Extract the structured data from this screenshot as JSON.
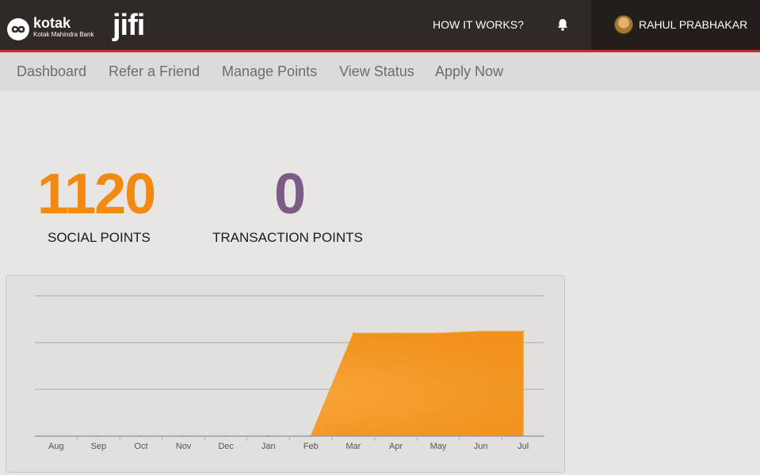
{
  "header": {
    "brand": {
      "name": "kotak",
      "subtitle": "Kotak Mahindra Bank",
      "product": "jifi"
    },
    "how_it_works": "HOW IT WORKS?",
    "notification_icon": "bell-icon",
    "user_name": "RAHUL PRABHAKAR",
    "accent_color": "#c8302f"
  },
  "nav": {
    "items": [
      {
        "label": "Dashboard"
      },
      {
        "label": "Refer a Friend"
      },
      {
        "label": "Manage Points"
      },
      {
        "label": "View Status"
      },
      {
        "label": "Apply Now"
      }
    ]
  },
  "stats": {
    "social": {
      "value": "1120",
      "label": "SOCIAL POINTS",
      "color": "#f08a12"
    },
    "transaction": {
      "value": "0",
      "label": "TRANSACTION POINTS",
      "color": "#7a5c86"
    }
  },
  "chart_data": {
    "type": "area",
    "categories": [
      "Aug",
      "Sep",
      "Oct",
      "Nov",
      "Dec",
      "Jan",
      "Feb",
      "Mar",
      "Apr",
      "May",
      "Jun",
      "Jul"
    ],
    "series": [
      {
        "values": [
          0,
          0,
          0,
          0,
          0,
          0,
          0,
          1100,
          1100,
          1100,
          1120,
          1120
        ],
        "color": "#f39a2a"
      }
    ],
    "ylim": [
      0,
      1500
    ],
    "grid": true,
    "xlabel": "",
    "ylabel": ""
  }
}
